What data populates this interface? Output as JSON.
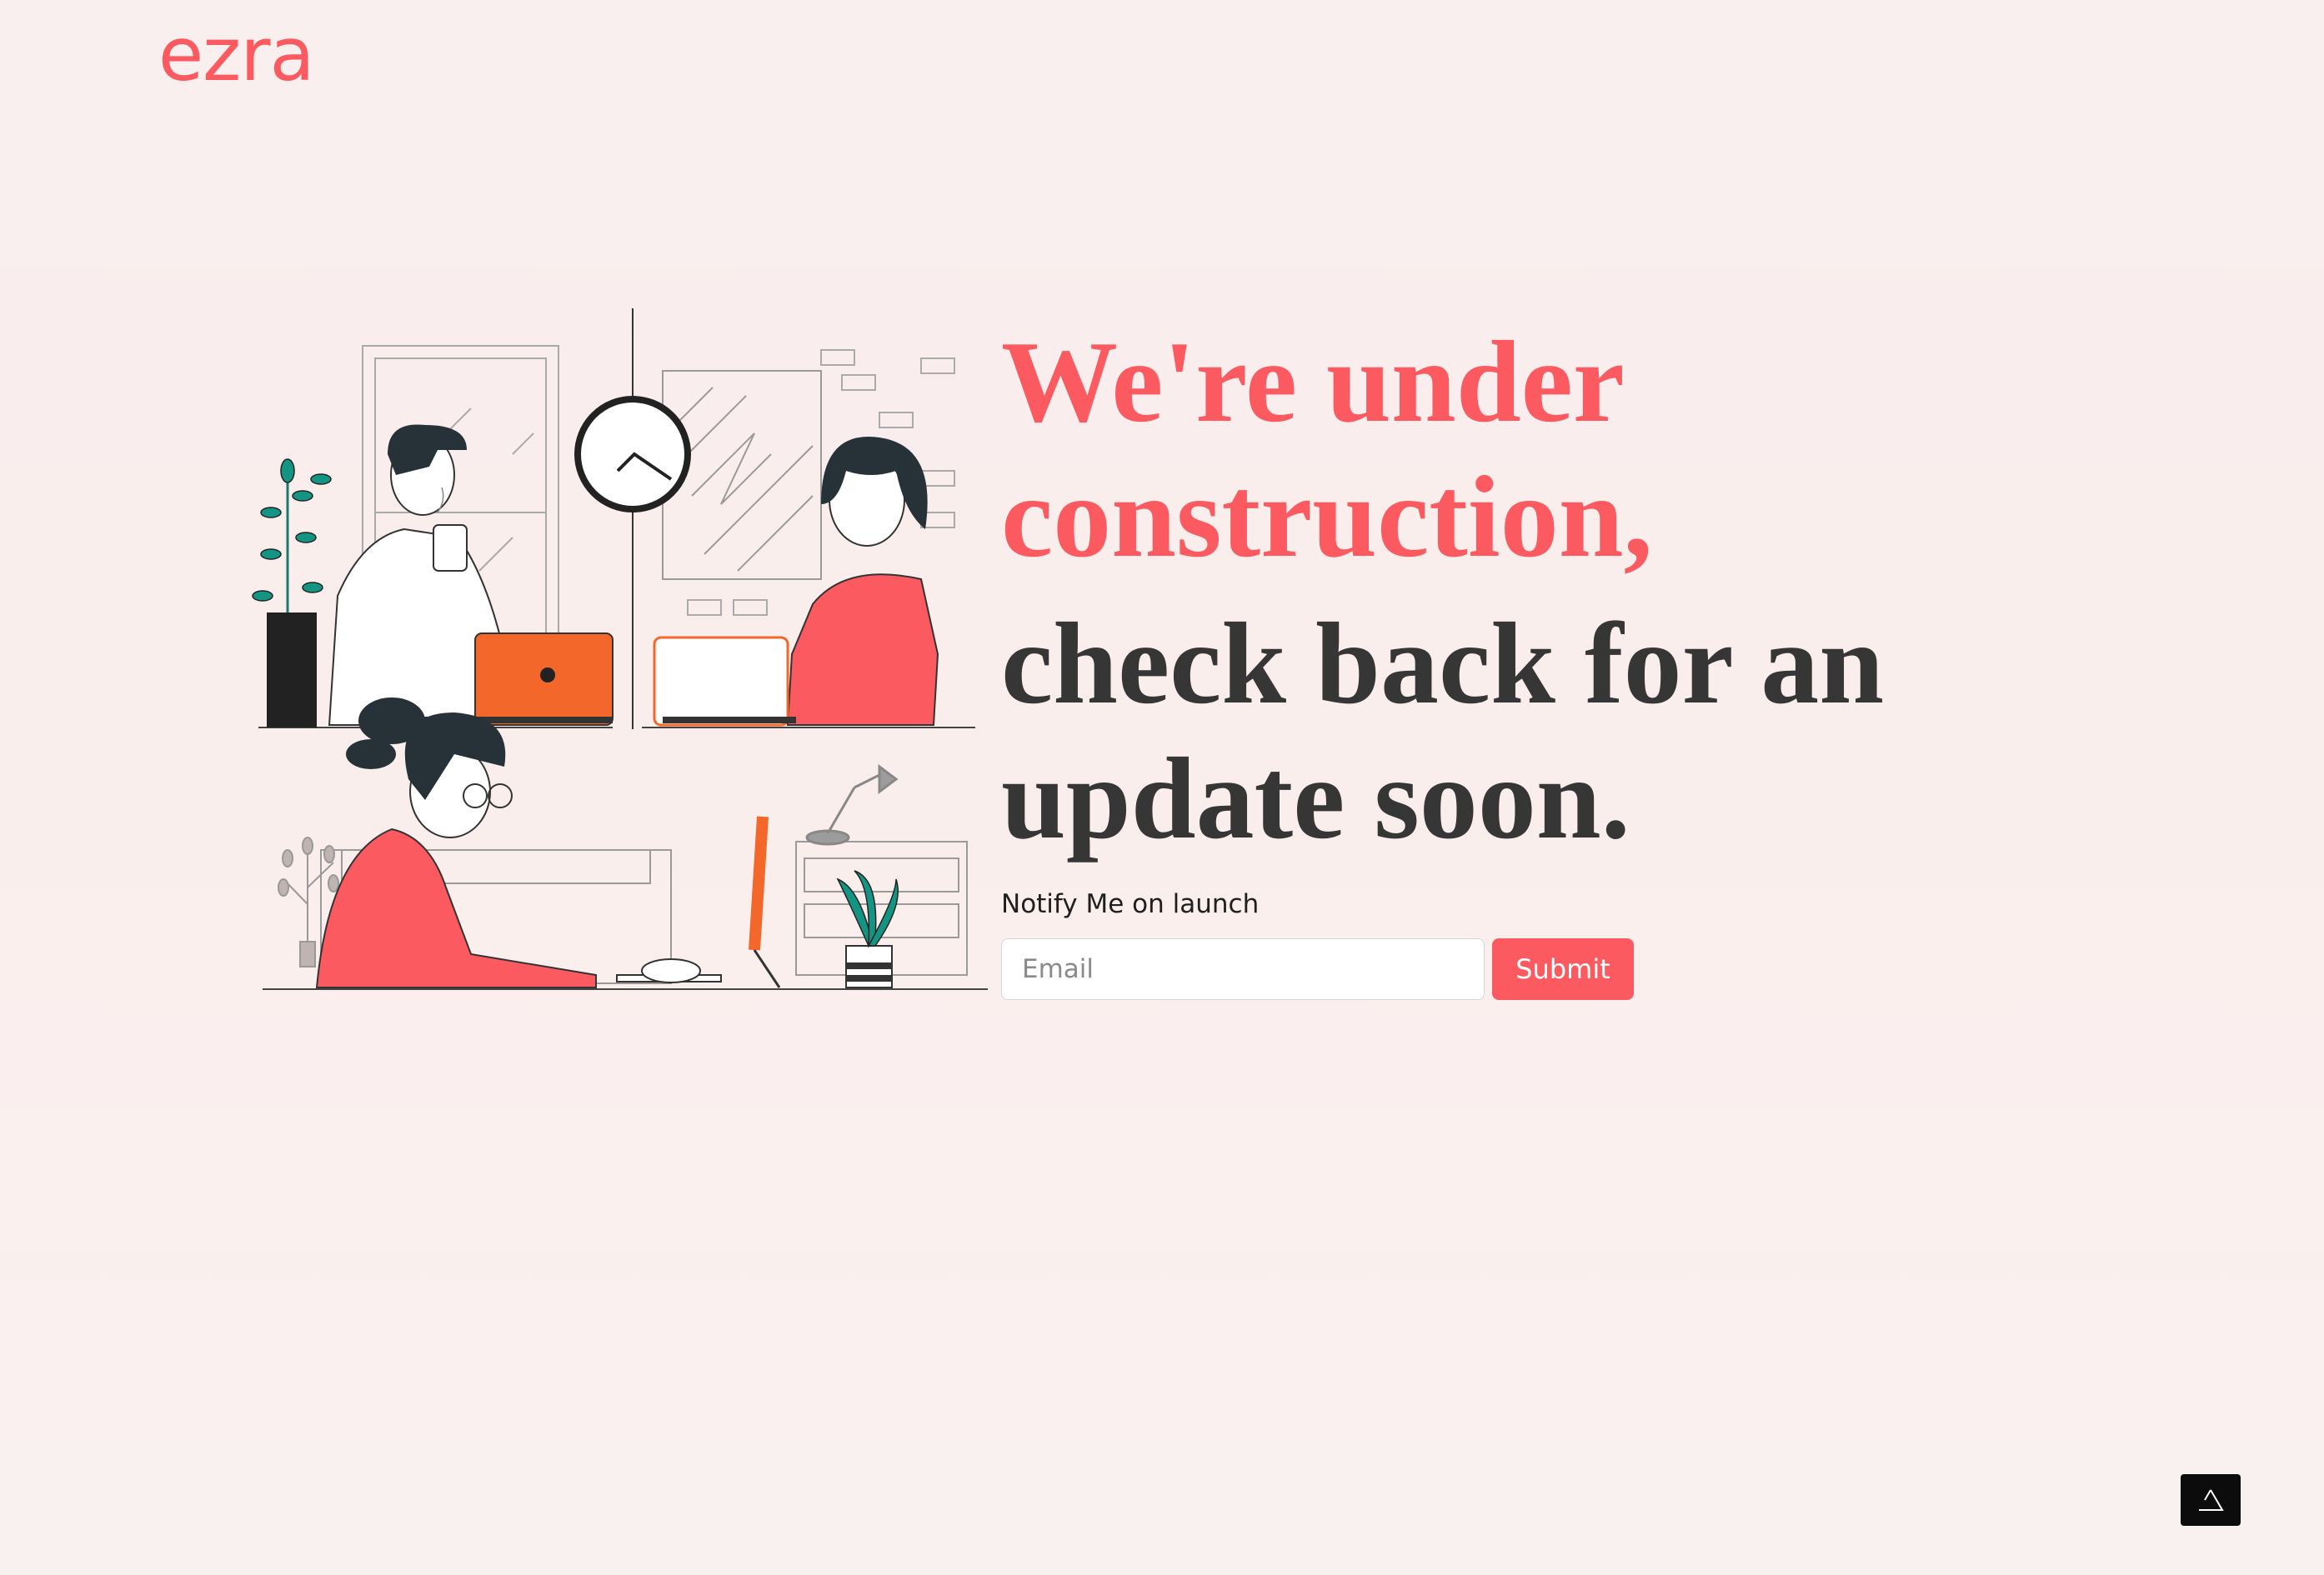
{
  "brand": {
    "logo_text": "ezra",
    "accent_color": "#fa5a60",
    "dark_text_color": "#363636"
  },
  "hero": {
    "headline_accent_line1": "We're under",
    "headline_accent_line2": "construction,",
    "headline_dark_line1": "check back for an",
    "headline_dark_line2": "update soon."
  },
  "notify": {
    "label": "Notify Me on launch",
    "email_placeholder": "Email",
    "email_value": "",
    "submit_label": "Submit"
  },
  "illustration": {
    "icon": "office-workers-illustration"
  },
  "corner_badge": {
    "icon": "triangle-logo-icon"
  }
}
